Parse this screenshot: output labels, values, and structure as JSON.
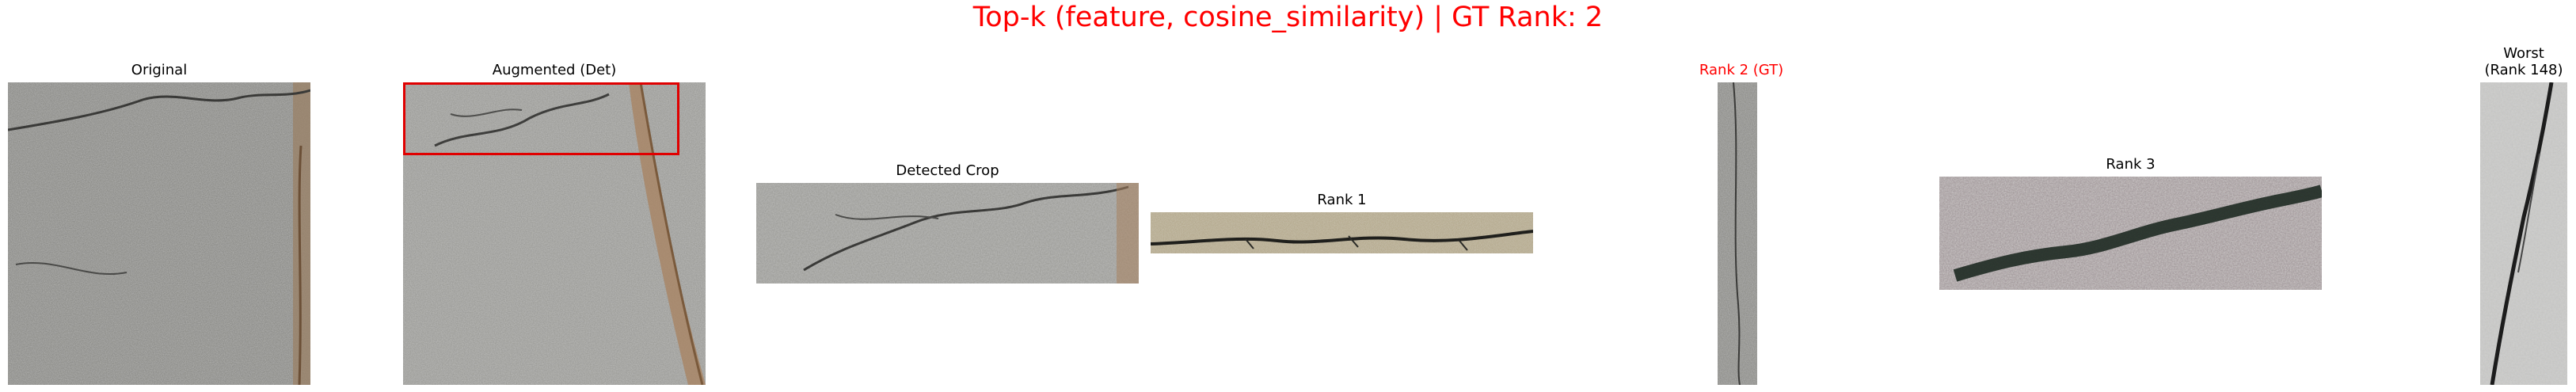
{
  "figure": {
    "title": "Top-k (feature, cosine_similarity) | GT Rank: 2",
    "title_color": "#ff0000"
  },
  "panels": [
    {
      "id": "original",
      "label": "Original",
      "label_color": "#000000"
    },
    {
      "id": "augmented",
      "label": "Augmented (Det)",
      "label_color": "#000000",
      "box_color": "#e00000"
    },
    {
      "id": "detected-crop",
      "label": "Detected Crop",
      "label_color": "#000000"
    },
    {
      "id": "rank-1",
      "label": "Rank 1",
      "label_color": "#000000"
    },
    {
      "id": "rank-2-gt",
      "label": "Rank 2 (GT)",
      "label_color": "#ff0000"
    },
    {
      "id": "rank-3",
      "label": "Rank 3",
      "label_color": "#000000"
    },
    {
      "id": "worst",
      "label": "Worst\n(Rank 148)",
      "label_color": "#000000"
    }
  ]
}
